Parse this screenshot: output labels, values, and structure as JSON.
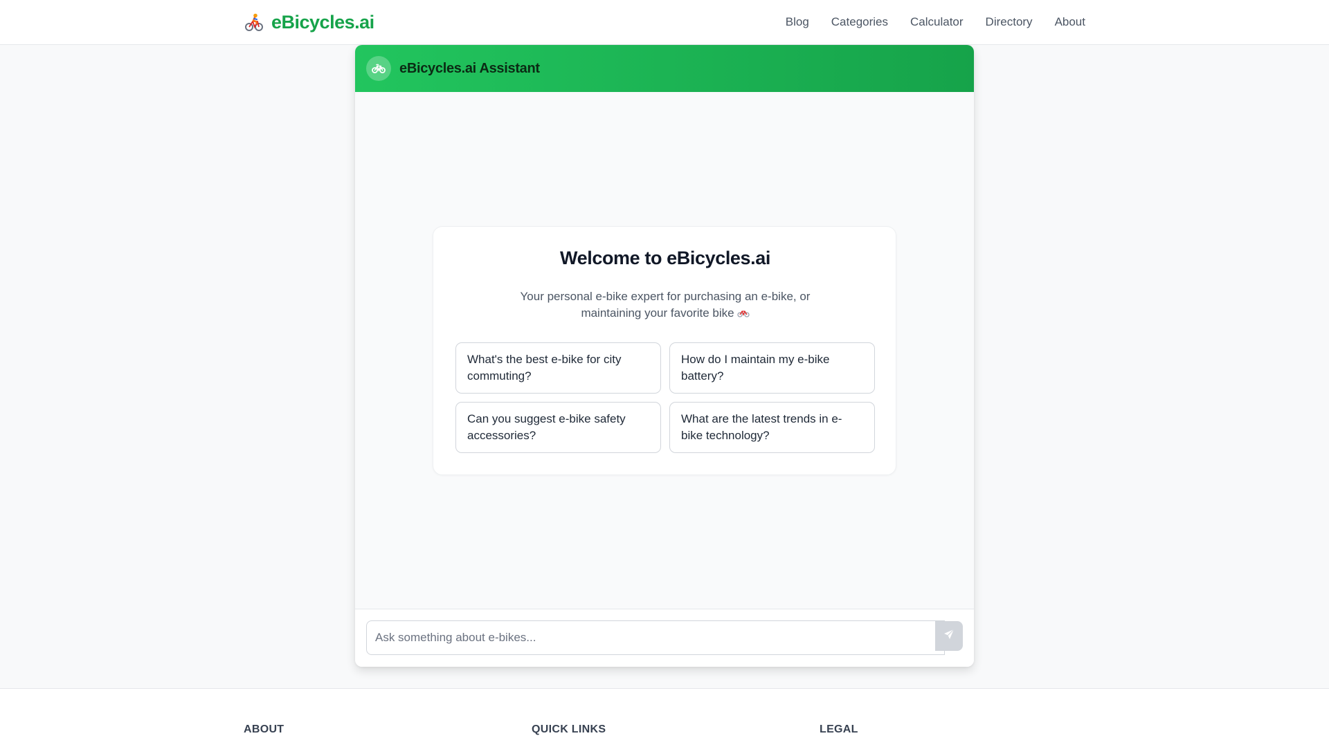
{
  "nav": {
    "brand_name": "eBicycles.ai",
    "brand_icon": "cyclist-icon",
    "links": [
      "Blog",
      "Categories",
      "Calculator",
      "Directory",
      "About"
    ]
  },
  "chat": {
    "header_title": "eBicycles.ai Assistant",
    "header_icon": "bicycle-icon",
    "welcome_title": "Welcome to eBicycles.ai",
    "welcome_subtitle": "Your personal e-bike expert for purchasing an e-bike, or maintaining your favorite bike",
    "suggestions": [
      "What's the best e-bike for city commuting?",
      "How do I maintain my e-bike battery?",
      "Can you suggest e-bike safety accessories?",
      "What are the latest trends in e-bike technology?"
    ],
    "input_placeholder": "Ask something about e-bikes...",
    "input_value": "",
    "send_icon": "send-icon"
  },
  "footer": {
    "headings": [
      "ABOUT",
      "QUICK LINKS",
      "LEGAL"
    ]
  },
  "colors": {
    "brand_green": "#16a34a",
    "header_gradient_start": "#22c55e",
    "header_gradient_end": "#16a34a",
    "send_button": "#d1d5db"
  }
}
